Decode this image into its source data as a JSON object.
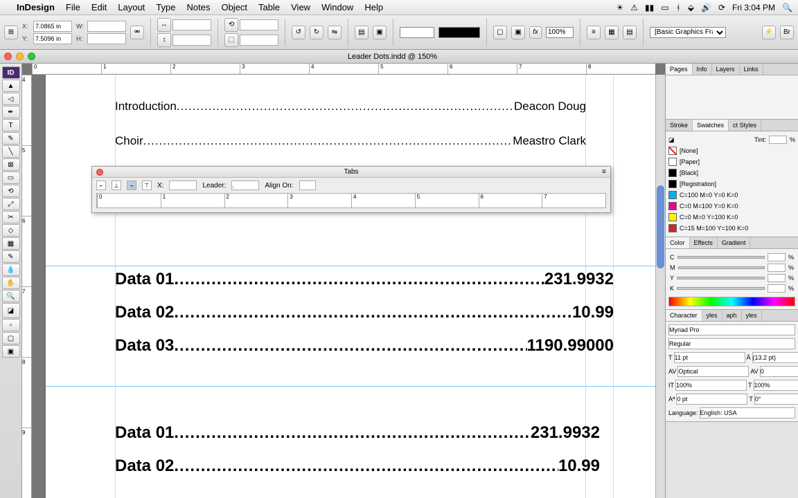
{
  "menubar": {
    "app": "InDesign",
    "items": [
      "File",
      "Edit",
      "Layout",
      "Type",
      "Notes",
      "Object",
      "Table",
      "View",
      "Window",
      "Help"
    ],
    "clock": "Fri 3:04 PM"
  },
  "controlbar": {
    "x": "7.0865 in",
    "y": "7.5096 in",
    "w": "",
    "h": "",
    "zoom": "100%",
    "frame_style": "[Basic Graphics Frame]+"
  },
  "document": {
    "title": "Leader Dots.indd @ 150%",
    "rows_top": [
      {
        "label": "Introduction",
        "value": "Deacon Doug"
      },
      {
        "label": "Choir",
        "value": "Meastro Clark"
      }
    ],
    "rows_data": [
      {
        "label": "Data 01",
        "value": "231.9932"
      },
      {
        "label": "Data 02",
        "value": "10.99"
      },
      {
        "label": "Data 03",
        "value": "1190.99000"
      }
    ],
    "rows_data2": [
      {
        "label": "Data 01",
        "value": "231.9932"
      },
      {
        "label": "Data 02",
        "value": "10.99"
      }
    ]
  },
  "tabs_panel": {
    "title": "Tabs",
    "x_label": "X:",
    "x_value": "",
    "leader_label": "Leader:",
    "leader_value": ".",
    "align_label": "Align On:",
    "align_value": "",
    "ruler_marks": [
      "0",
      "1",
      "2",
      "3",
      "4",
      "5",
      "6",
      "7"
    ]
  },
  "panels": {
    "top_tabs": [
      "Pages",
      "Info",
      "Layers",
      "Links"
    ],
    "swatch_tabs": [
      "Stroke",
      "Swatches",
      "ct Styles"
    ],
    "tint_label": "Tint:",
    "swatches": [
      {
        "name": "[None]",
        "color": "#ffffff",
        "none": true
      },
      {
        "name": "[Paper]",
        "color": "#ffffff"
      },
      {
        "name": "[Black]",
        "color": "#000000"
      },
      {
        "name": "[Registration]",
        "color": "#000000"
      },
      {
        "name": "C=100 M=0 Y=0 K=0",
        "color": "#00aeef"
      },
      {
        "name": "C=0 M=100 Y=0 K=0",
        "color": "#ec008c"
      },
      {
        "name": "C=0 M=0 Y=100 K=0",
        "color": "#fff200"
      },
      {
        "name": "C=15 M=100 Y=100 K=0",
        "color": "#d2232a"
      }
    ],
    "color_tabs": [
      "Color",
      "Effects",
      "Gradient"
    ],
    "color_ch": [
      "C",
      "M",
      "Y",
      "K"
    ],
    "char_tabs": [
      "Character",
      "yles",
      "aph",
      "yles"
    ],
    "font": "Myriad Pro",
    "style": "Regular",
    "size": "11 pt",
    "leading": "(13.2 pt)",
    "kerning": "Optical",
    "tracking": "0",
    "vscale": "100%",
    "hscale": "100%",
    "baseline": "0 pt",
    "skew": "0°",
    "lang_label": "Language:",
    "lang": "English: USA"
  },
  "ruler_h": [
    "0",
    "1",
    "2",
    "3",
    "4",
    "5",
    "6",
    "7",
    "8"
  ],
  "ruler_v": [
    "4",
    "5",
    "6",
    "7",
    "8",
    "9"
  ]
}
